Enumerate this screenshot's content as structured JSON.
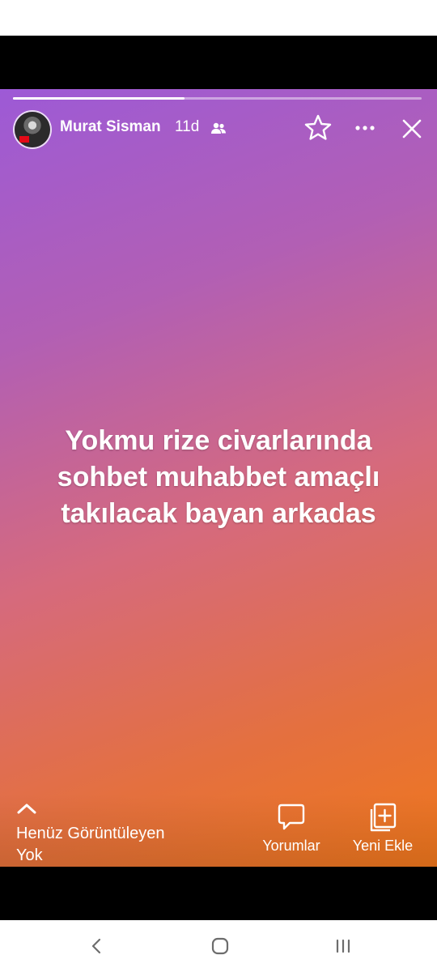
{
  "story": {
    "author_name": "Murat Sisman",
    "time_ago": "11d",
    "progress": 0.42,
    "text_lines": [
      "Yokmu rize civarlarında",
      "sohbet muhabbet amaçlı",
      "takılacak bayan arkadas"
    ],
    "gradient_colors": [
      "#9d5ad6",
      "#d66a7c",
      "#f0771c"
    ],
    "icons": {
      "audience": "friends-icon",
      "favorite": "star-icon",
      "more": "more-icon",
      "close": "close-icon"
    }
  },
  "footer": {
    "viewers_line1": "Henüz Görüntüleyen",
    "viewers_line2": "Yok",
    "comments_label": "Yorumlar",
    "add_label": "Yeni Ekle"
  },
  "system_nav": {
    "icons": [
      "back-icon",
      "home-icon",
      "recents-icon"
    ]
  }
}
